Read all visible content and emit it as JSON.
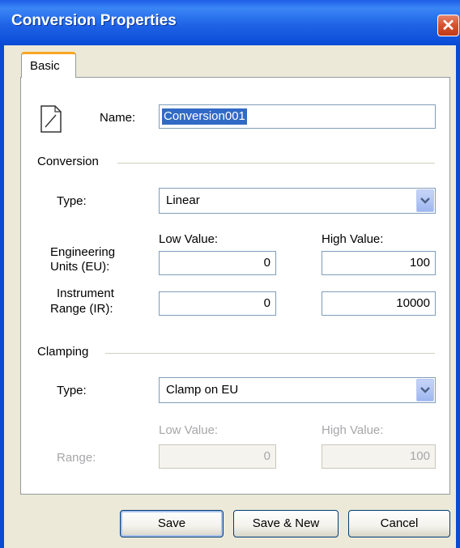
{
  "window": {
    "title": "Conversion Properties",
    "close_glyph": "✕"
  },
  "tabs": [
    {
      "label": "Basic",
      "selected": true
    }
  ],
  "name_field": {
    "label": "Name:",
    "value": "Conversion001"
  },
  "conversion": {
    "group_label": "Conversion",
    "type_label": "Type:",
    "type_value": "Linear",
    "low_header": "Low Value:",
    "high_header": "High Value:",
    "eu_label_line1": "Engineering",
    "eu_label_line2": "Units (EU):",
    "eu_low": "0",
    "eu_high": "100",
    "ir_label_line1": "Instrument",
    "ir_label_line2": "Range (IR):",
    "ir_low": "0",
    "ir_high": "10000"
  },
  "clamping": {
    "group_label": "Clamping",
    "type_label": "Type:",
    "type_value": "Clamp on EU",
    "low_header": "Low Value:",
    "high_header": "High Value:",
    "range_label": "Range:",
    "range_low": "0",
    "range_high": "100"
  },
  "buttons": {
    "save": "Save",
    "save_new": "Save & New",
    "cancel": "Cancel"
  },
  "colors": {
    "titlebar": "#1f63e6",
    "tab_accent": "#f5a623",
    "selection": "#316ac5",
    "close_button": "#d6502f"
  },
  "icons": {
    "document": "document-icon",
    "dropdown": "chevron-down-icon",
    "close": "close-icon"
  }
}
